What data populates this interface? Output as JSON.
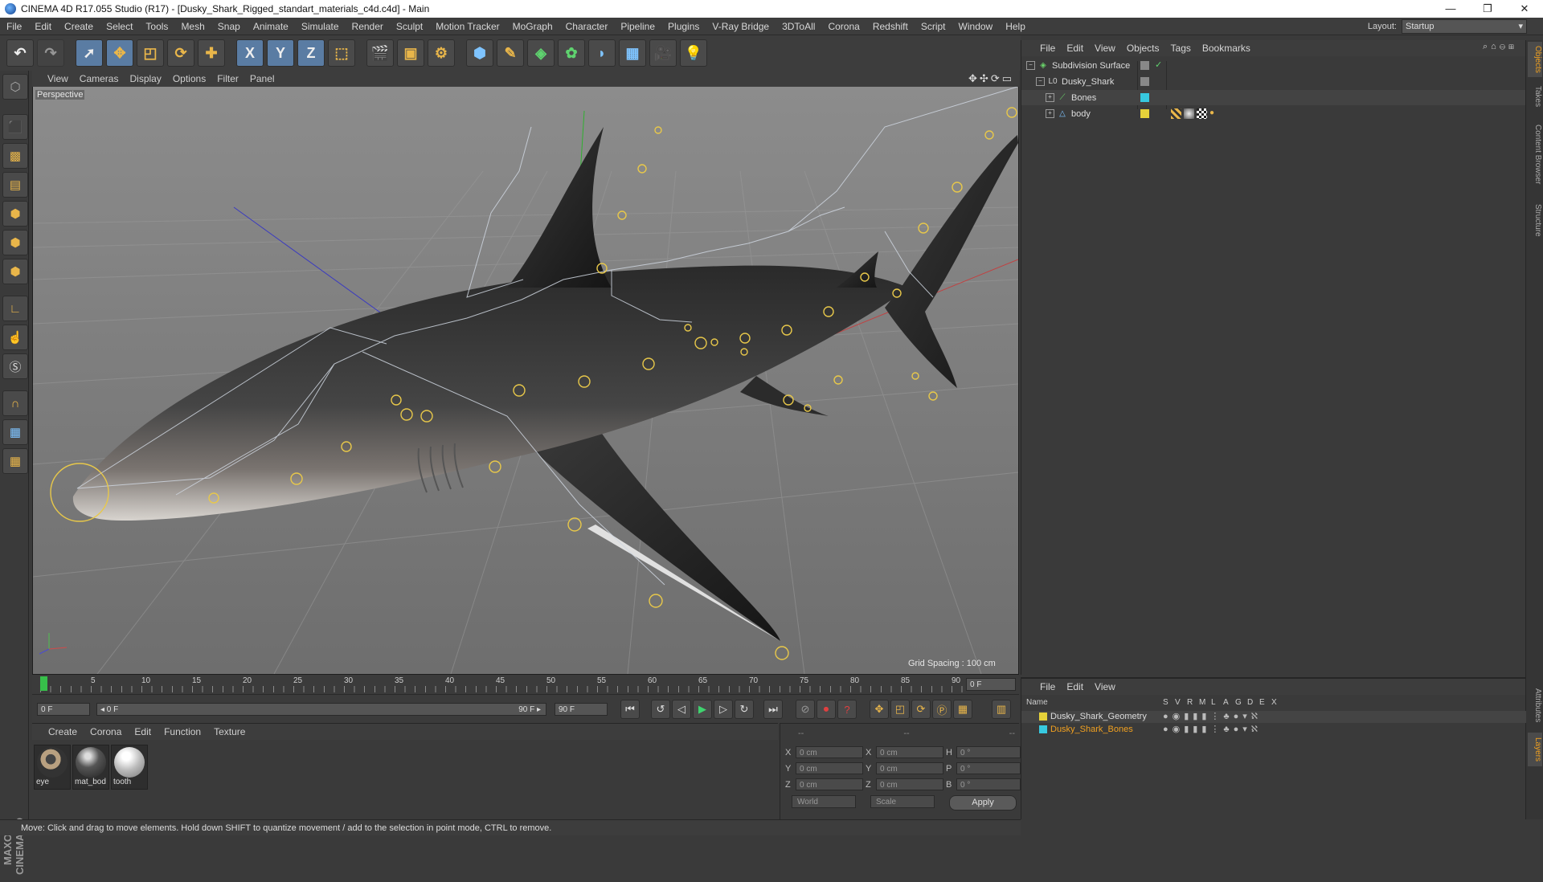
{
  "window": {
    "title": "CINEMA 4D R17.055 Studio (R17) - [Dusky_Shark_Rigged_standart_materials_c4d.c4d] - Main",
    "controls": [
      "—",
      "❐",
      "✕"
    ]
  },
  "menubar": {
    "items": [
      "File",
      "Edit",
      "Create",
      "Select",
      "Tools",
      "Mesh",
      "Snap",
      "Animate",
      "Simulate",
      "Render",
      "Sculpt",
      "Motion Tracker",
      "MoGraph",
      "Character",
      "Pipeline",
      "Plugins",
      "V-Ray Bridge",
      "3DToAll",
      "Corona",
      "Redshift",
      "Script",
      "Window",
      "Help"
    ],
    "layout_label": "Layout:",
    "layout_value": "Startup"
  },
  "toolbar": {
    "icons": [
      "undo-icon",
      "redo-icon",
      "live-selection-icon",
      "move-icon",
      "scale-icon",
      "rotate-icon",
      "move-plus-icon",
      "x-axis-icon",
      "y-axis-icon",
      "z-axis-icon",
      "coordinate-system-icon",
      "render-view-icon",
      "render-picture-viewer-icon",
      "edit-render-settings-icon",
      "cube-icon",
      "pen-icon",
      "subdivision-icon",
      "cloner-icon",
      "deformer-icon",
      "floor-icon",
      "camera-icon",
      "light-icon"
    ],
    "axis_labels": [
      "X",
      "Y",
      "Z"
    ]
  },
  "viewport": {
    "menu": [
      "View",
      "Cameras",
      "Display",
      "Options",
      "Filter",
      "Panel"
    ],
    "camera_label": "Perspective",
    "grid_spacing": "Grid Spacing : 100 cm"
  },
  "timeline": {
    "ticks": [
      "0",
      "5",
      "10",
      "15",
      "20",
      "25",
      "30",
      "35",
      "40",
      "45",
      "50",
      "55",
      "60",
      "65",
      "70",
      "75",
      "80",
      "85",
      "90"
    ],
    "current_frame": "0 F",
    "start_frame": "0 F",
    "range_start": "◂ 0 F",
    "range_end": "90 F ▸",
    "end_frame": "90 F"
  },
  "materials": {
    "menu": [
      "Create",
      "Corona",
      "Edit",
      "Function",
      "Texture"
    ],
    "items": [
      {
        "name": "eye"
      },
      {
        "name": "mat_bod"
      },
      {
        "name": "tooth"
      }
    ]
  },
  "coordinates": {
    "header": [
      "--",
      "--",
      "--"
    ],
    "rows": [
      {
        "a": "X",
        "av": "0 cm",
        "b": "X",
        "bv": "0 cm",
        "c": "H",
        "cv": "0 °"
      },
      {
        "a": "Y",
        "av": "0 cm",
        "b": "Y",
        "bv": "0 cm",
        "c": "P",
        "cv": "0 °"
      },
      {
        "a": "Z",
        "av": "0 cm",
        "b": "Z",
        "bv": "0 cm",
        "c": "B",
        "cv": "0 °"
      }
    ],
    "world": "World",
    "scale": "Scale",
    "apply": "Apply"
  },
  "status": "Move: Click and drag to move elements. Hold down SHIFT to quantize movement / add to the selection in point mode, CTRL to remove.",
  "object_manager": {
    "menu": [
      "File",
      "Edit",
      "View",
      "Objects",
      "Tags",
      "Bookmarks"
    ],
    "objects": [
      {
        "name": "Subdivision Surface",
        "color": "#6ad46a"
      },
      {
        "name": "Dusky_Shark",
        "color": "#cfcfcf"
      },
      {
        "name": "Bones",
        "color": "#6ad46a"
      },
      {
        "name": "body",
        "color": "#7fc4ff"
      }
    ]
  },
  "layer_manager": {
    "menu": [
      "File",
      "Edit",
      "View"
    ],
    "columns": [
      "Name",
      "S",
      "V",
      "R",
      "M",
      "L",
      "A",
      "G",
      "D",
      "E",
      "X"
    ],
    "layers": [
      {
        "name": "Dusky_Shark_Geometry",
        "color": "#e6d23a"
      },
      {
        "name": "Dusky_Shark_Bones",
        "color": "#37c9e0"
      }
    ]
  },
  "right_tabs": [
    "Objects",
    "Takes",
    "Content Browser",
    "Structure",
    "Attributes",
    "Layers"
  ],
  "logo_text": "MAXON CINEMA 4D"
}
